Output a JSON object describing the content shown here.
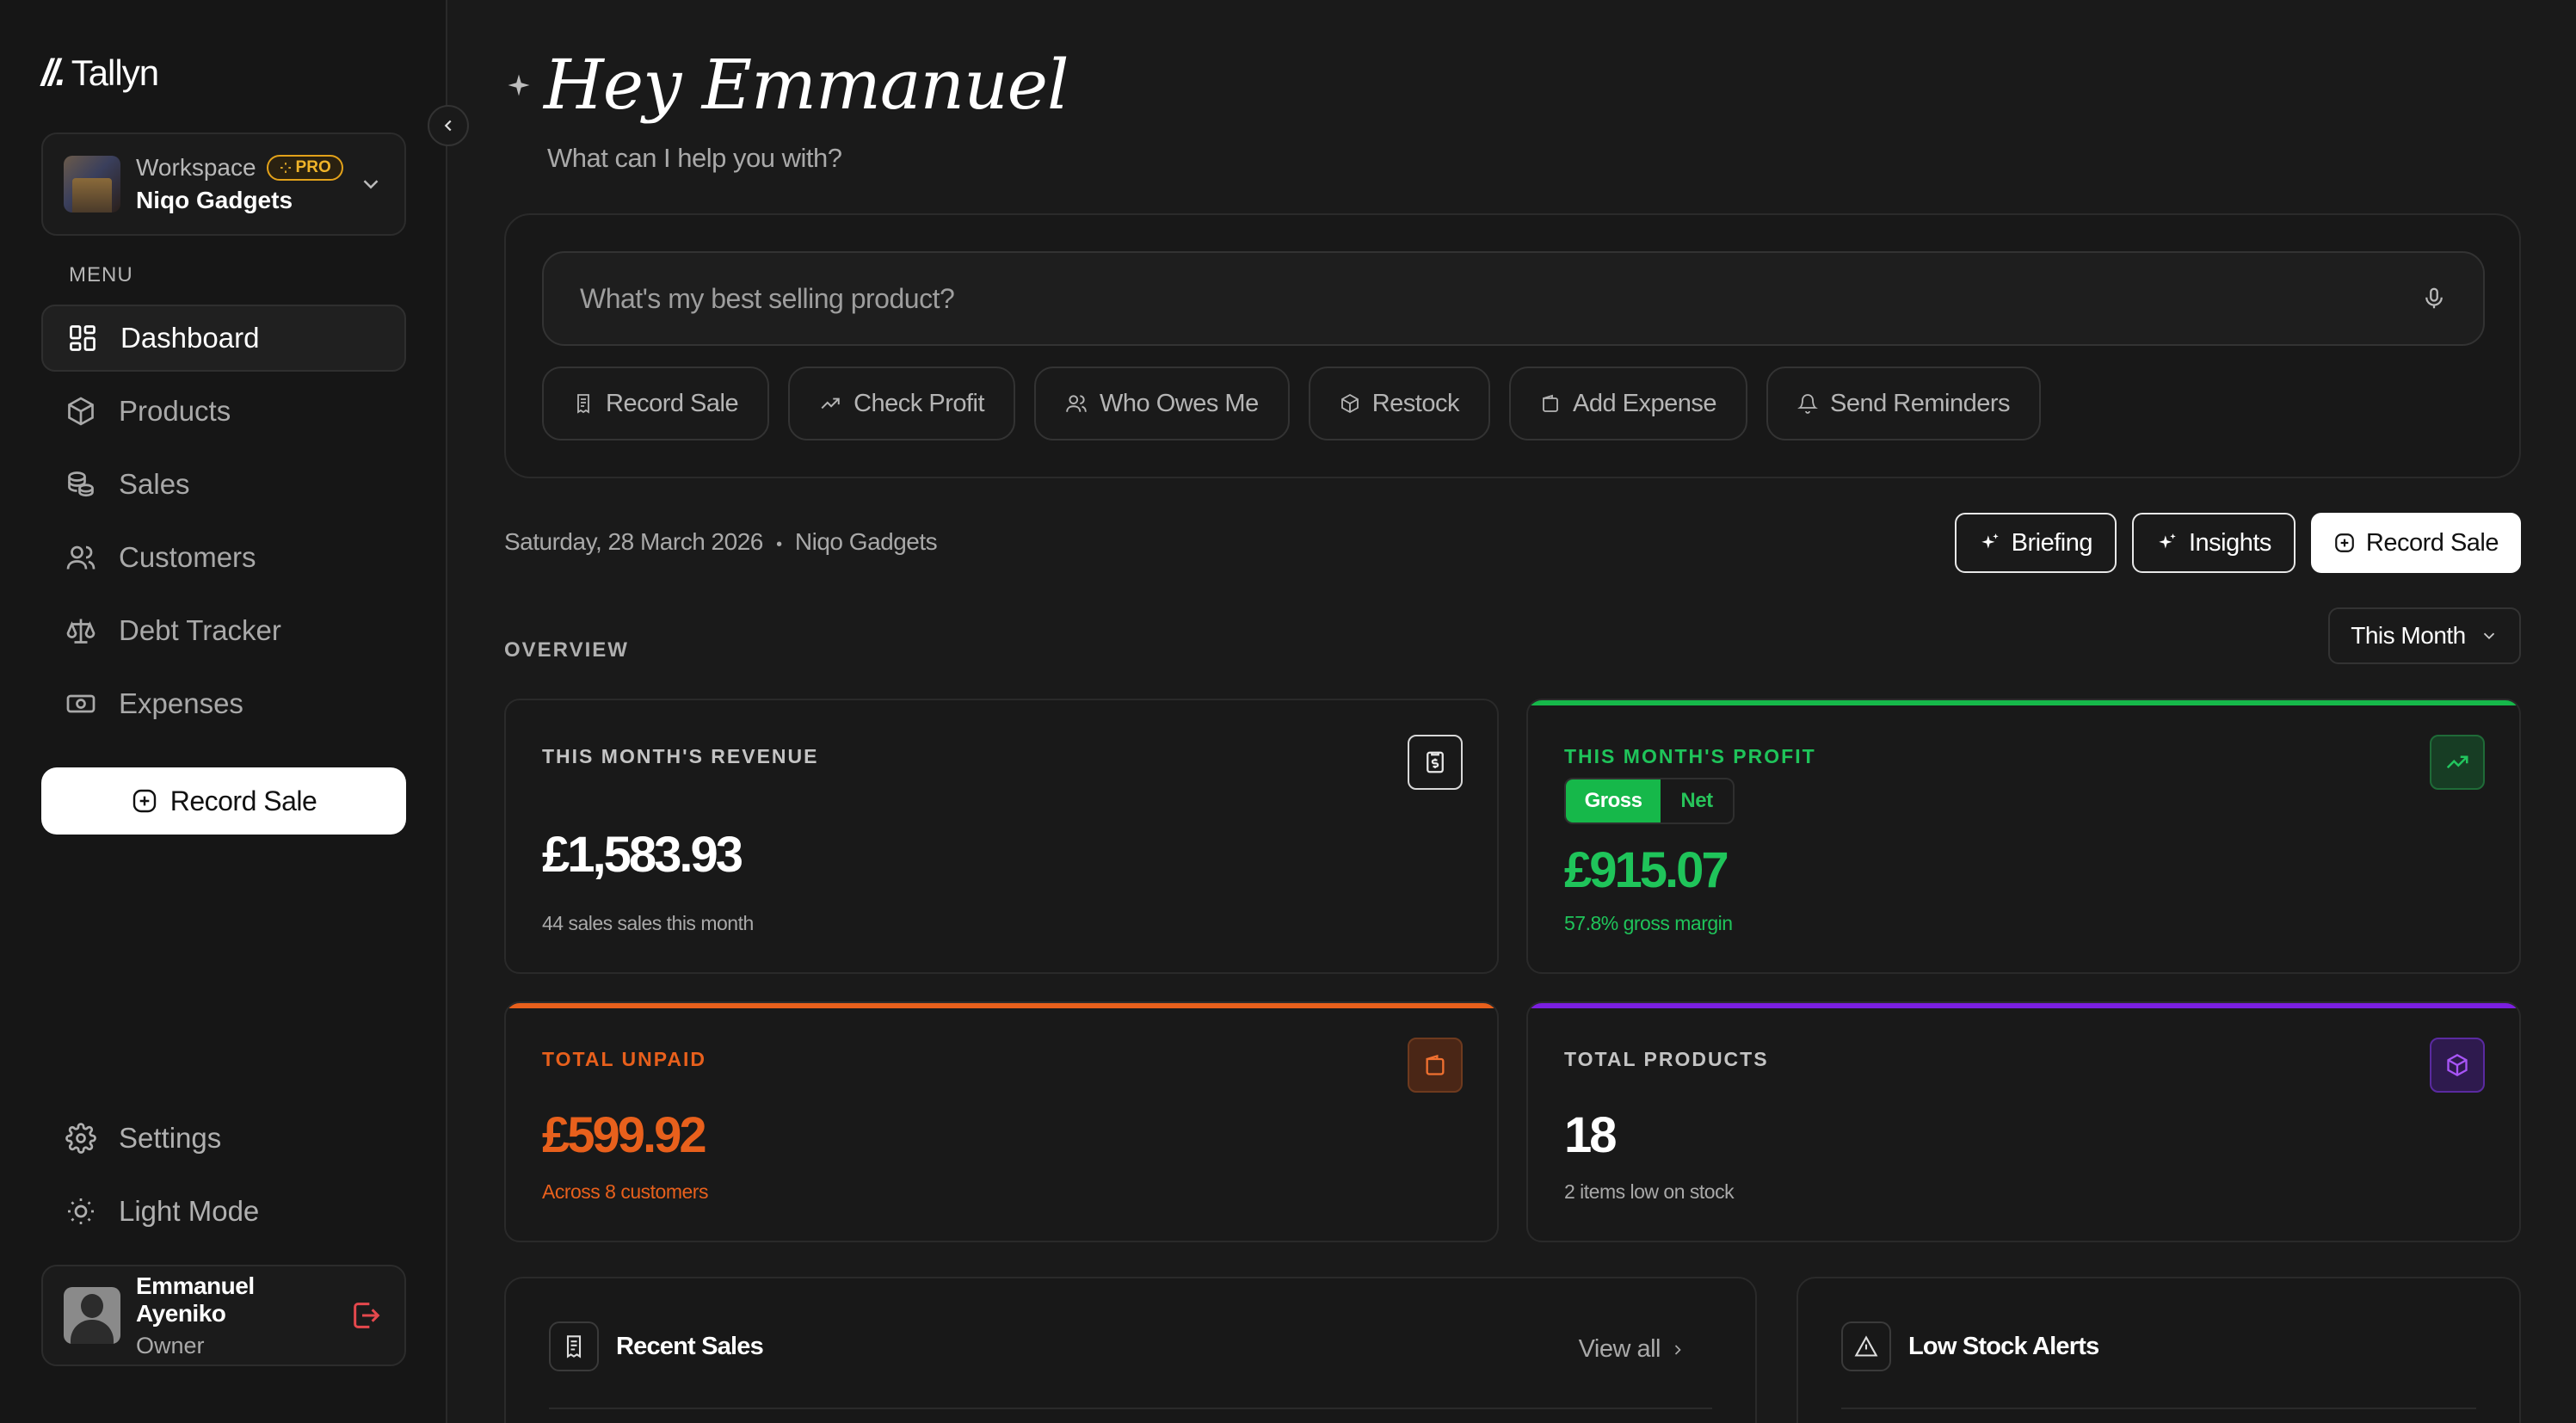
{
  "brand": {
    "name": "Tallyn"
  },
  "workspace": {
    "label": "Workspace",
    "badge": "PRO",
    "name": "Niqo Gadgets"
  },
  "sidebar": {
    "menu_label": "MENU",
    "items": [
      {
        "label": "Dashboard",
        "icon": "dashboard-icon",
        "active": true
      },
      {
        "label": "Products",
        "icon": "box-icon"
      },
      {
        "label": "Sales",
        "icon": "coins-icon"
      },
      {
        "label": "Customers",
        "icon": "users-icon"
      },
      {
        "label": "Debt Tracker",
        "icon": "scale-icon"
      },
      {
        "label": "Expenses",
        "icon": "banknote-icon"
      }
    ],
    "record_sale_label": "Record Sale",
    "bottom_items": [
      {
        "label": "Settings",
        "icon": "gear-icon"
      },
      {
        "label": "Light Mode",
        "icon": "sun-icon"
      }
    ]
  },
  "user": {
    "name": "Emmanuel Ayeniko",
    "role": "Owner"
  },
  "greeting": {
    "title": "Hey Emmanuel",
    "subtitle": "What can I help you with?"
  },
  "ask": {
    "placeholder": "What's my best selling product?",
    "chips": [
      "Record Sale",
      "Check Profit",
      "Who Owes Me",
      "Restock",
      "Add Expense",
      "Send Reminders"
    ]
  },
  "date_line": {
    "date": "Saturday, 28 March 2026",
    "separator": "•",
    "business": "Niqo Gadgets"
  },
  "actions": {
    "briefing": "Briefing",
    "insights": "Insights",
    "record_sale": "Record Sale"
  },
  "overview": {
    "label": "OVERVIEW",
    "period": "This Month"
  },
  "cards": {
    "revenue": {
      "title": "THIS MONTH'S REVENUE",
      "value": "£1,583.93",
      "sub": "44 sales sales this month"
    },
    "profit": {
      "title": "THIS MONTH'S PROFIT",
      "toggle_on": "Gross",
      "toggle_off": "Net",
      "value": "£915.07",
      "sub": "57.8% gross margin"
    },
    "unpaid": {
      "title": "TOTAL UNPAID",
      "value": "£599.92",
      "sub": "Across 8 customers"
    },
    "products": {
      "title": "TOTAL PRODUCTS",
      "value": "18",
      "sub": "2 items low on stock"
    }
  },
  "panels": {
    "recent_sales": {
      "title": "Recent Sales",
      "link": "View all"
    },
    "low_stock": {
      "title": "Low Stock Alerts"
    }
  },
  "colors": {
    "background": "#1a1a1a",
    "green": "#16b84a",
    "orange": "#e8601c",
    "purple": "#7b1fe0",
    "pro_gold": "#f0b429",
    "logout_red": "#e5484d"
  }
}
